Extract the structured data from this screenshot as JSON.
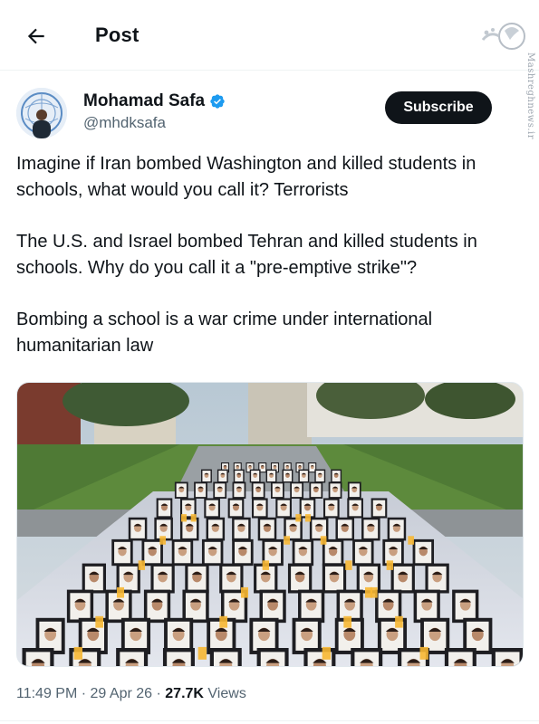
{
  "header": {
    "title": "Post",
    "back_icon": "arrow-left-icon"
  },
  "watermark": {
    "side_text": "Mashreghnews.ir"
  },
  "author": {
    "name": "Mohamad Safa",
    "handle": "@mhdksafa",
    "verified_icon": "verified-badge-icon",
    "verified_color": "#1d9bf0"
  },
  "subscribe": {
    "label": "Subscribe"
  },
  "post": {
    "paragraphs": [
      "Imagine if Iran bombed Washington and killed students in schools, what would you call it? Terrorists",
      "The U.S. and Israel bombed Tehran and killed students in schools. Why do you call it a \"pre-emptive strike\"?",
      "Bombing a school is a war crime under international humanitarian law"
    ]
  },
  "media": {
    "description_icon": "photo-memorial-icon"
  },
  "meta": {
    "time": "11:49 PM",
    "separator": "·",
    "date": "29 Apr 26",
    "views_count": "27.7K",
    "views_label": "Views"
  },
  "colors": {
    "text_primary": "#0f1419",
    "text_secondary": "#536471",
    "button_bg": "#0f1419",
    "divider": "#eff3f4"
  }
}
